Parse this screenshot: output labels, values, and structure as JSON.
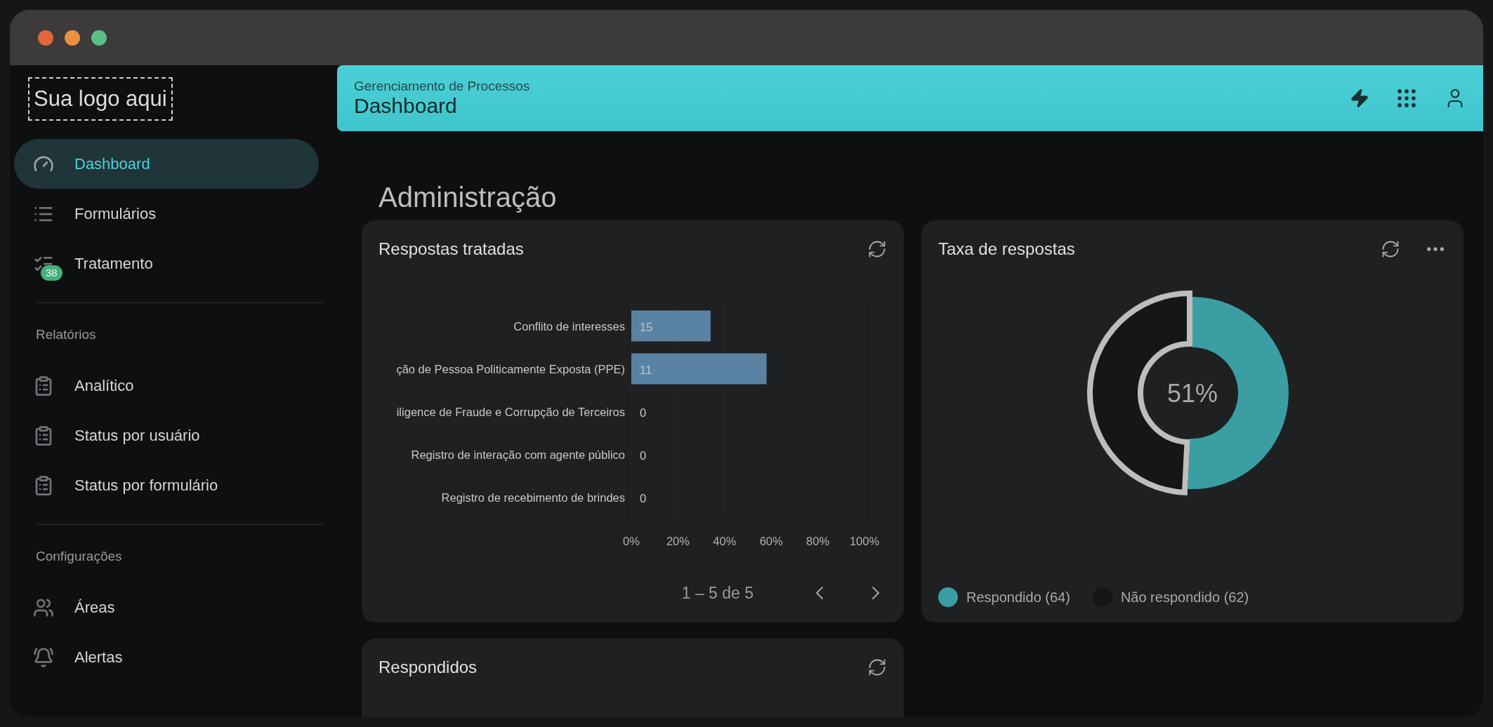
{
  "window": {
    "controls": [
      {
        "color": "#e0663c"
      },
      {
        "color": "#e99140"
      },
      {
        "color": "#5dbf84"
      }
    ]
  },
  "logo": "Sua logo aqui",
  "sidebar": {
    "groups": [
      {
        "items": [
          {
            "label": "Dashboard",
            "selected": true
          },
          {
            "label": "Formulários",
            "selected": false
          },
          {
            "label": "Tratamento",
            "selected": false,
            "badge": "38"
          }
        ]
      },
      {
        "title": "Relatórios",
        "items": [
          {
            "label": "Analítico",
            "selected": false
          },
          {
            "label": "Status por usuário",
            "selected": false
          },
          {
            "label": "Status por formulário",
            "selected": false
          }
        ]
      },
      {
        "title": "Configurações",
        "items": [
          {
            "label": "Áreas",
            "selected": false
          },
          {
            "label": "Alertas",
            "selected": false
          }
        ]
      }
    ]
  },
  "header": {
    "subtitle": "Gerenciamento de Processos",
    "title": "Dashboard"
  },
  "page_title": "Administração",
  "responses_card": {
    "title": "Respostas tratadas",
    "chart_data": {
      "type": "bar",
      "orientation": "horizontal",
      "categories": [
        "Conflito de interesses",
        "ção de Pessoa Politicamente Exposta (PPE)",
        "iligence de Fraude e Corrupção de Terceiros",
        "Registro de interação com agente público",
        "Registro de recebimento de brindes"
      ],
      "values": [
        34,
        58,
        0,
        0,
        0
      ],
      "xlim": [
        0,
        100
      ],
      "grid": true,
      "xticks": [
        {
          "value": 0,
          "label": "0%"
        },
        {
          "value": 20,
          "label": "20%"
        },
        {
          "value": 40,
          "label": "40%"
        },
        {
          "value": 60,
          "label": "60%"
        },
        {
          "value": 80,
          "label": "80%"
        },
        {
          "value": 100,
          "label": "100%"
        }
      ]
    },
    "response_counts": [
      "15",
      "11",
      "0",
      "0",
      "0"
    ],
    "pagination": "1 – 5 de 5"
  },
  "rate_card": {
    "title": "Taxa de respostas",
    "center_label": "51%",
    "legend": [
      {
        "color": "#3a9ea3"
      },
      {
        "color": "#151618"
      }
    ],
    "chart_data": {
      "type": "donut",
      "categories": [
        "Respondido (64)",
        "Não respondido (62)"
      ],
      "values": [
        64,
        62
      ]
    }
  },
  "answered_card": {
    "title": "Respondidos"
  }
}
